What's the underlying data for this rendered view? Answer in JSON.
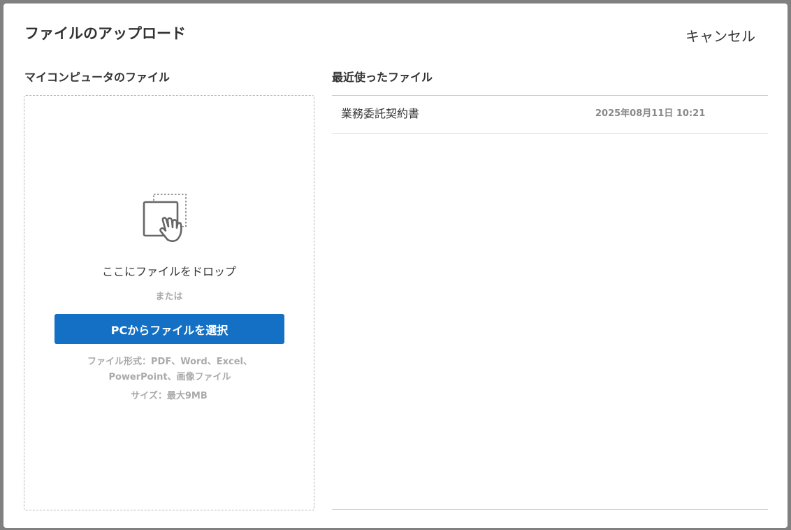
{
  "dialog": {
    "title": "ファイルのアップロード",
    "cancel_label": "キャンセル"
  },
  "left_panel": {
    "heading": "マイコンピュータのファイル",
    "drop_icon": "drag-drop-hand-icon",
    "drop_text": "ここにファイルをドロップ",
    "or_text": "または",
    "select_button_label": "PCからファイルを選択",
    "format_line1": "ファイル形式：PDF、Word、Excel、",
    "format_line2": "PowerPoint、画像ファイル",
    "size_text": "サイズ：最大9MB"
  },
  "right_panel": {
    "heading": "最近使ったファイル",
    "files": [
      {
        "name": "業務委託契約書",
        "date": "2025年08月11日 10:21"
      }
    ]
  },
  "colors": {
    "primary": "#1370c4",
    "overlay": "#808080",
    "muted_text": "#aaaaaa"
  }
}
